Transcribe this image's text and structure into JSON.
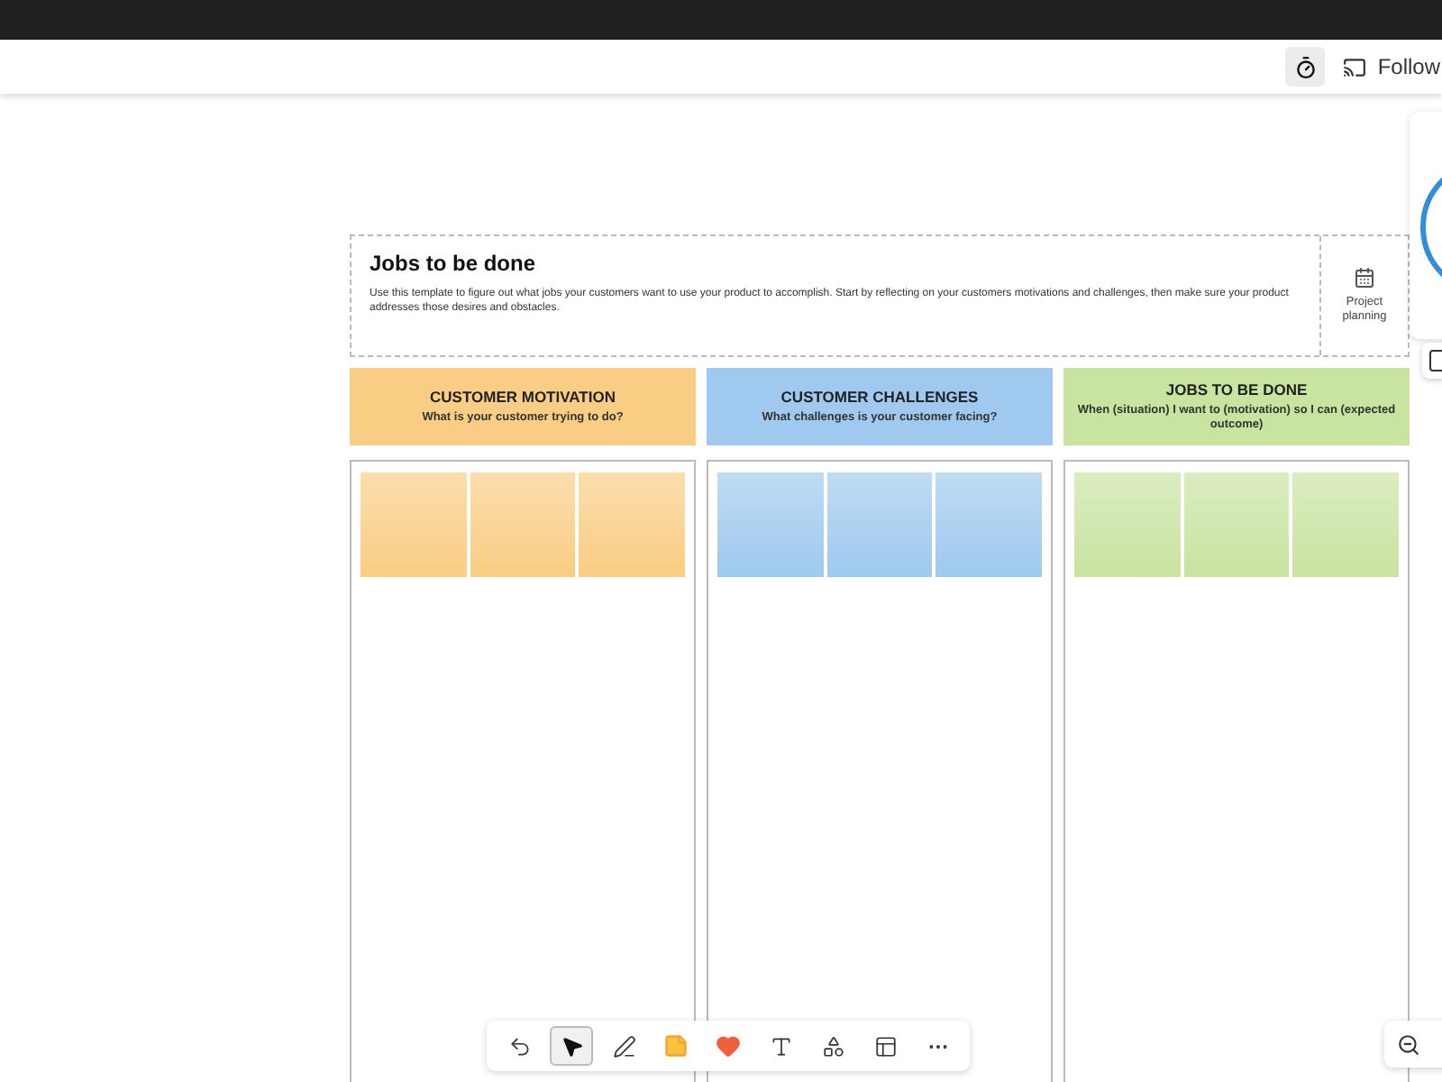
{
  "topbar": {
    "follow_label": "Follow",
    "timer_active": true
  },
  "template": {
    "title": "Jobs to be done",
    "description": "Use this template to figure out what jobs your customers want to use your product to accomplish. Start by reflecting on your customers motivations and challenges, then make sure your product addresses those desires and obstacles.",
    "category": "Project planning"
  },
  "columns": [
    {
      "title": "CUSTOMER MOTIVATION",
      "subtitle": "What is your customer trying to do?",
      "color": "#f9cd83"
    },
    {
      "title": "CUSTOMER CHALLENGES",
      "subtitle": "What challenges is your customer facing?",
      "color": "#9fc9ee"
    },
    {
      "title": "JOBS TO BE DONE",
      "subtitle": "When (situation) I want to (motivation) so I can (expected outcome)",
      "color": "#c9e3a0"
    }
  ],
  "tools": [
    {
      "kind": "undo",
      "selected": false
    },
    {
      "kind": "select",
      "selected": true
    },
    {
      "kind": "pen",
      "selected": false
    },
    {
      "kind": "sticky",
      "selected": false
    },
    {
      "kind": "reaction",
      "selected": false
    },
    {
      "kind": "text",
      "selected": false
    },
    {
      "kind": "shapes",
      "selected": false
    },
    {
      "kind": "template",
      "selected": false
    },
    {
      "kind": "more",
      "selected": false
    }
  ]
}
